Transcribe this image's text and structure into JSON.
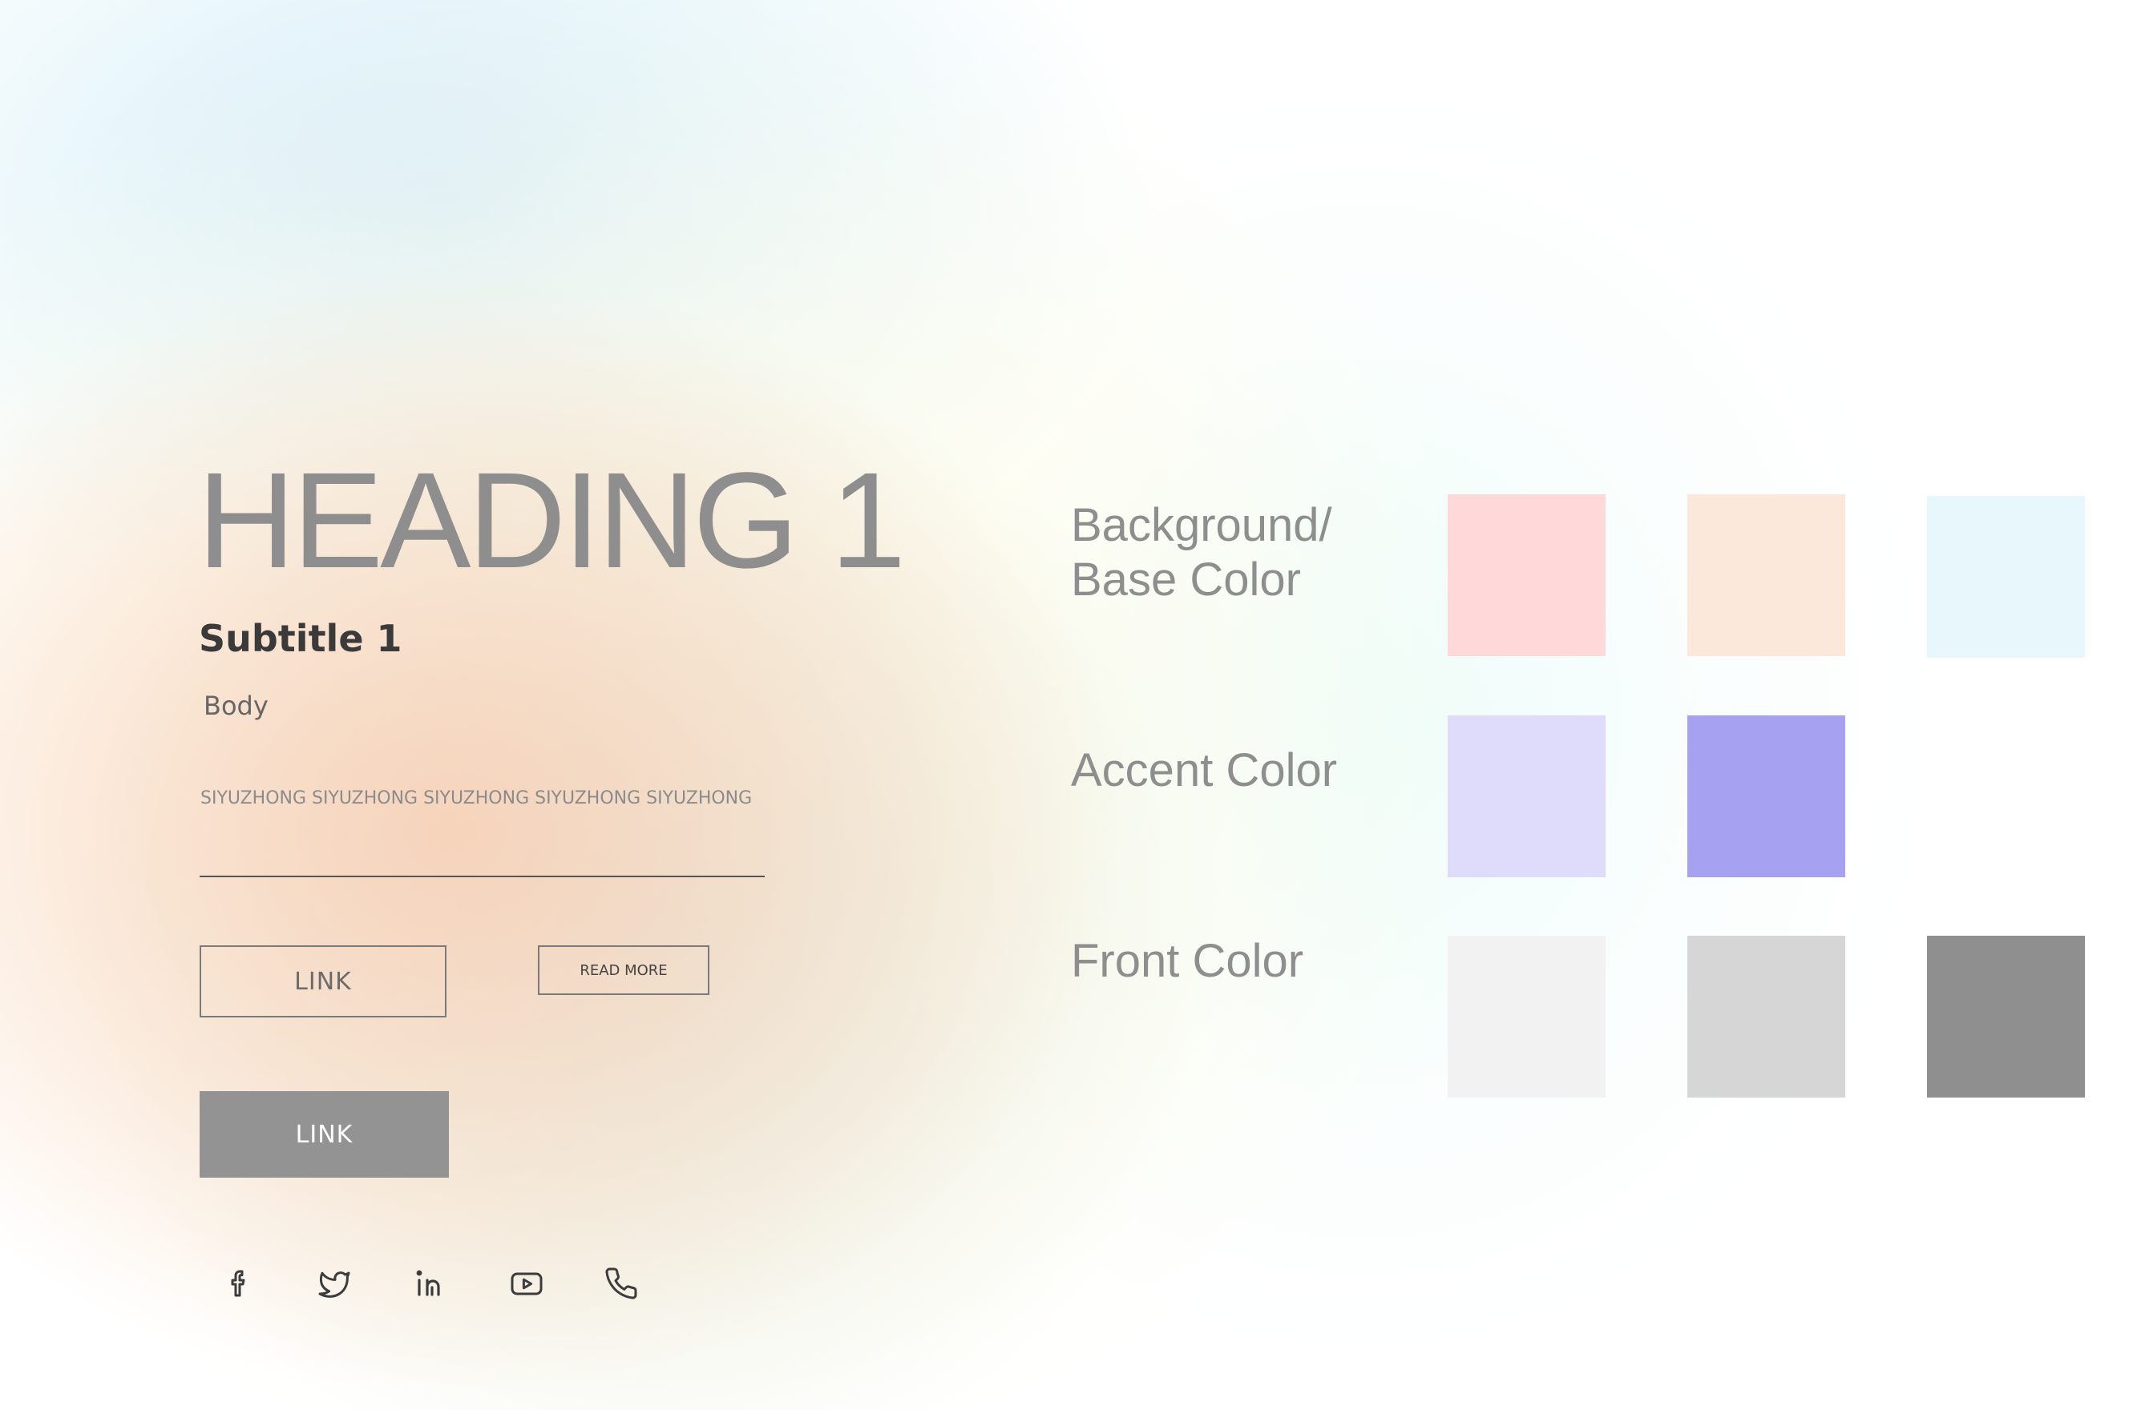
{
  "typography": {
    "heading1": "HEADING 1",
    "subtitle1": "Subtitle 1",
    "body": "Body",
    "caption": "SIYUZHONG SIYUZHONG SIYUZHONG SIYUZHONG SIYUZHONG"
  },
  "buttons": {
    "link_outline": "LINK",
    "read_more": "READ MORE",
    "link_filled": "LINK",
    "filled_color": "#939393"
  },
  "social_icons": [
    "facebook-icon",
    "twitter-icon",
    "linkedin-icon",
    "youtube-icon",
    "phone-icon"
  ],
  "palette": {
    "background": {
      "label_line1": "Background/",
      "label_line2": "Base Color",
      "colors": [
        "#FFD8D9",
        "#FBE8DA",
        "#E8F7FC"
      ]
    },
    "accent": {
      "label": "Accent Color",
      "colors": [
        "#DEDCFA",
        "#A7A1F2"
      ]
    },
    "front": {
      "label": "Front Color",
      "colors": [
        "#F2F2F2",
        "#D6D6D6",
        "#8F8F8F"
      ]
    }
  }
}
